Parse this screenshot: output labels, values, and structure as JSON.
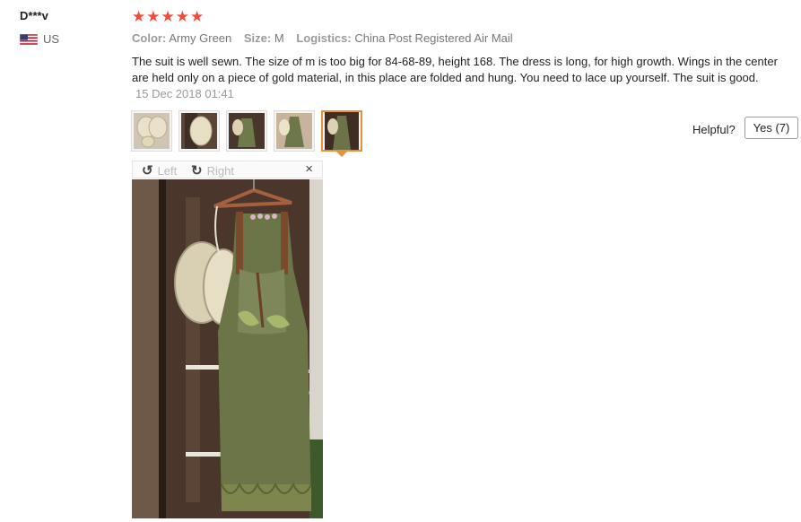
{
  "reviewer": {
    "name": "D***v",
    "country": "US"
  },
  "rating": {
    "stars": 5,
    "max": 5,
    "color": "#f04b3a"
  },
  "meta": [
    {
      "key": "Color:",
      "value": "Army Green"
    },
    {
      "key": "Size:",
      "value": "M"
    },
    {
      "key": "Logistics:",
      "value": "China Post Registered Air Mail"
    }
  ],
  "review": {
    "text": "The suit is well sewn. The size of m is too big for 84-68-89, height 168. The dress is long, for high growth. Wings in the center are held only on a piece of gold material, in this place are folded and hung. You need to lace up yourself. The suit is good.",
    "date": "15 Dec 2018 01:41"
  },
  "thumbnails": {
    "count": 5,
    "active_index": 4,
    "accent": "#e8913c"
  },
  "helpful": {
    "label": "Helpful?",
    "yes_label": "Yes (7)"
  },
  "viewer": {
    "rotate_left": "Left",
    "rotate_right": "Right",
    "close": "×"
  }
}
